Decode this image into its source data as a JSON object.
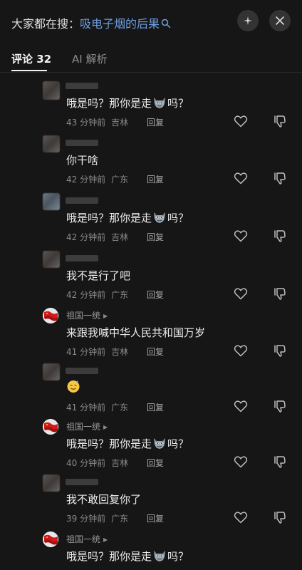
{
  "header": {
    "search_prefix": "大家都在搜：",
    "search_keyword": "吸电子烟的后果",
    "search_icon": "search-icon",
    "sparkle_icon": "sparkle-icon",
    "close_icon": "close-icon"
  },
  "tabs": [
    {
      "label": "评论 32",
      "active": true
    },
    {
      "label": "AI 解析",
      "active": false
    }
  ],
  "comments": [
    {
      "username": "",
      "text_before": "哦是吗？那你是走",
      "emoji": "wolf-emoji",
      "text_after": "吗？",
      "time": "43 分钟前",
      "location": "吉林",
      "reply_label": "回复"
    },
    {
      "username": "",
      "text": "你干啥",
      "time": "42 分钟前",
      "location": "广东",
      "reply_label": "回复"
    },
    {
      "username": "",
      "text_before": "哦是吗？那你是走",
      "emoji": "wolf-emoji",
      "text_after": "吗？",
      "time": "42 分钟前",
      "location": "吉林",
      "reply_label": "回复"
    },
    {
      "username": "",
      "text": "我不是行了吧",
      "time": "42 分钟前",
      "location": "广东",
      "reply_label": "回复"
    },
    {
      "username": "祖国一统",
      "text": "来跟我喊中华人民共和国万岁",
      "time": "41 分钟前",
      "location": "吉林",
      "reply_label": "回复"
    },
    {
      "username": "",
      "emoji": "sweat-smile-emoji",
      "time": "41 分钟前",
      "location": "广东",
      "reply_label": "回复"
    },
    {
      "username": "祖国一统",
      "text_before": "哦是吗？那你是走",
      "emoji": "wolf-emoji",
      "text_after": "吗？",
      "time": "40 分钟前",
      "location": "吉林",
      "reply_label": "回复"
    },
    {
      "username": "",
      "text": "我不敢回复你了",
      "time": "39 分钟前",
      "location": "广东",
      "reply_label": "回复"
    },
    {
      "username": "祖国一统",
      "text_before": "哦是吗？那你是走",
      "emoji": "wolf-emoji",
      "text_after": "吗？"
    }
  ],
  "icons": {
    "like": "heart-icon",
    "dislike": "thumbs-down-icon"
  },
  "colors": {
    "background": "#161616",
    "keyword": "#6f9fe0",
    "meta": "#8a8a8a"
  }
}
